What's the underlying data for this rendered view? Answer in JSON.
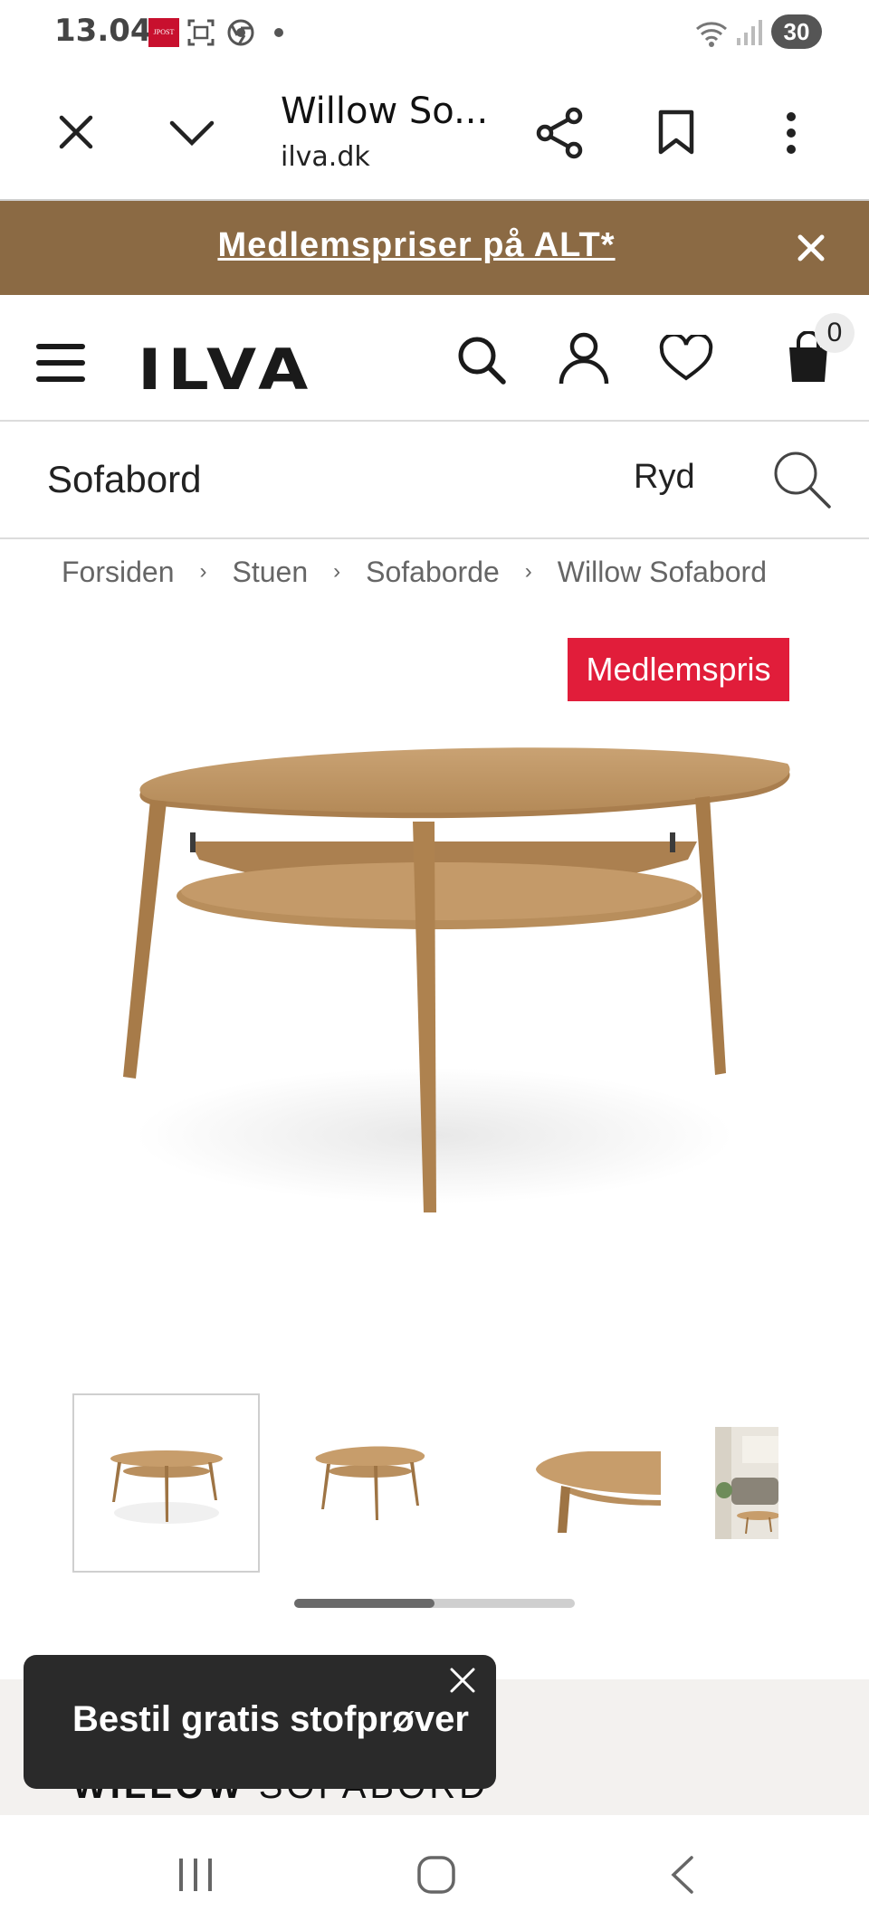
{
  "status_bar": {
    "time": "13.04",
    "notification_badge": "JPOST",
    "battery": "30",
    "icons": [
      "jpost-app-icon",
      "screenshot-icon",
      "chrome-icon",
      "dot-icon",
      "wifi-icon",
      "signal-icon"
    ]
  },
  "browser": {
    "title": "Willow So...",
    "domain": "ilva.dk",
    "icons": [
      "close-icon",
      "chevron-down-icon",
      "share-icon",
      "bookmark-icon",
      "more-vert-icon"
    ]
  },
  "promo": {
    "text": "Medlemspriser på ALT*",
    "background": "#8b6a44"
  },
  "header": {
    "logo": "ILVA",
    "cart_count": "0",
    "icons": [
      "menu-icon",
      "search-icon",
      "account-icon",
      "heart-icon",
      "bag-icon"
    ]
  },
  "search": {
    "value": "Sofabord",
    "clear_label": "Ryd"
  },
  "breadcrumb": [
    "Forsiden",
    "Stuen",
    "Sofaborde",
    "Willow Sofabord"
  ],
  "product": {
    "badge": "Medlemspris",
    "badge_color": "#e11d3a",
    "name_bold": "WILLOW",
    "name_light": "SOFABORD"
  },
  "gallery": {
    "thumbnail_count": 4,
    "active_index": 0,
    "scroll_position": 0.5
  },
  "toast": {
    "text": "Bestil gratis stofprøver"
  },
  "android_nav": {
    "icons": [
      "recents-icon",
      "home-icon",
      "back-icon"
    ]
  }
}
